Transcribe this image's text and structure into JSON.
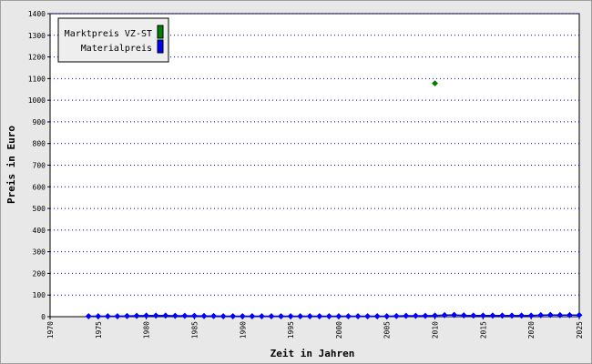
{
  "chart_data": {
    "type": "scatter",
    "xlabel": "Zeit in Jahren",
    "ylabel": "Preis in Euro",
    "xlim": [
      1970,
      2025
    ],
    "ylim": [
      0,
      1400
    ],
    "xticks": [
      1970,
      1975,
      1980,
      1985,
      1990,
      1995,
      2000,
      2005,
      2010,
      2015,
      2020,
      2025
    ],
    "yticks": [
      0,
      100,
      200,
      300,
      400,
      500,
      600,
      700,
      800,
      900,
      1000,
      1100,
      1200,
      1300,
      1400
    ],
    "grid": true,
    "legend_position": "top-left",
    "series": [
      {
        "name": "Marktpreis VZ-ST",
        "color": "#008000",
        "marker": "diamond",
        "connected": false,
        "x": [
          2010
        ],
        "y": [
          1078
        ]
      },
      {
        "name": "Materialpreis",
        "color": "#0000ff",
        "marker": "diamond",
        "connected": true,
        "x": [
          1974,
          1975,
          1976,
          1977,
          1978,
          1979,
          1980,
          1981,
          1982,
          1983,
          1984,
          1985,
          1986,
          1987,
          1988,
          1989,
          1990,
          1991,
          1992,
          1993,
          1994,
          1995,
          1996,
          1997,
          1998,
          1999,
          2000,
          2001,
          2002,
          2003,
          2004,
          2005,
          2006,
          2007,
          2008,
          2009,
          2010,
          2011,
          2012,
          2013,
          2014,
          2015,
          2016,
          2017,
          2018,
          2019,
          2020,
          2021,
          2022,
          2023,
          2024,
          2025
        ],
        "y": [
          2,
          2,
          2,
          2,
          3,
          4,
          5,
          5,
          5,
          4,
          4,
          4,
          3,
          3,
          2,
          2,
          2,
          2,
          2,
          2,
          2,
          2,
          2,
          2,
          2,
          2,
          2,
          2,
          2,
          2,
          2,
          2,
          3,
          4,
          4,
          4,
          5,
          7,
          8,
          6,
          5,
          5,
          5,
          5,
          5,
          5,
          5,
          7,
          8,
          7,
          7,
          7
        ]
      }
    ]
  }
}
